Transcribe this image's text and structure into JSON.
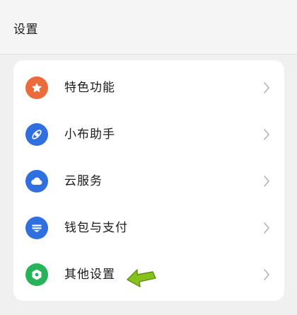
{
  "header": {
    "title": "设置"
  },
  "items": [
    {
      "label": "特色功能",
      "icon": "star-icon",
      "color": "#ec6b3c"
    },
    {
      "label": "小布助手",
      "icon": "assistant-icon",
      "color": "#2f6fe0"
    },
    {
      "label": "云服务",
      "icon": "cloud-icon",
      "color": "#2f6fe0"
    },
    {
      "label": "钱包与支付",
      "icon": "wallet-icon",
      "color": "#2f6fe0"
    },
    {
      "label": "其他设置",
      "icon": "gear-icon",
      "color": "#27b35b"
    }
  ],
  "annotation": {
    "arrow_color": "#86c21a"
  }
}
